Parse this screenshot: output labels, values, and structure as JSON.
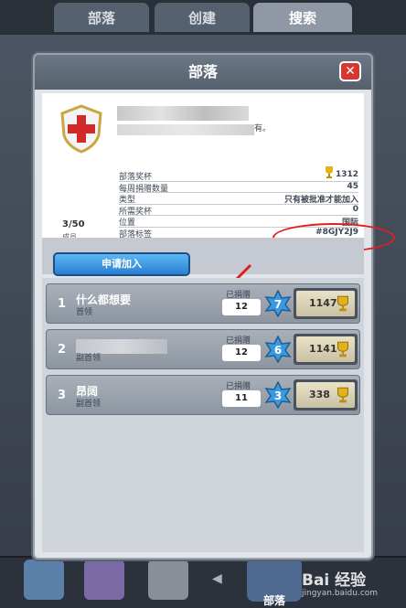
{
  "top_tabs": [
    {
      "label": "部落"
    },
    {
      "label": "创建"
    },
    {
      "label": "搜索"
    }
  ],
  "modal": {
    "title": "部落",
    "close_symbol": "✕",
    "description_tail": "有。",
    "stats": [
      {
        "label": "部落奖杯",
        "value": "1312"
      },
      {
        "label": "每周捐赠数量",
        "value": "45"
      },
      {
        "label": "类型",
        "value": "只有被批准才能加入"
      },
      {
        "label": "所需奖杯",
        "value": "0"
      },
      {
        "label": "位置",
        "value": "国际"
      },
      {
        "label": "部落标签",
        "value": "#8GJY2J9"
      }
    ],
    "members_count": "3/50",
    "members_label": "成员",
    "join_button": "申请加入",
    "members": [
      {
        "rank": "1",
        "name": "什么都想要",
        "role": "首领",
        "donated_label": "已捐赠",
        "donated": "12",
        "level": "7",
        "trophies": "1147"
      },
      {
        "rank": "2",
        "name": "",
        "role": "副首领",
        "donated_label": "已捐赠",
        "donated": "12",
        "level": "6",
        "trophies": "1141"
      },
      {
        "rank": "3",
        "name": "昂阔",
        "role": "副首领",
        "donated_label": "已捐赠",
        "donated": "11",
        "level": "3",
        "trophies": "338"
      }
    ]
  },
  "bottom_nav": {
    "active_label": "部落"
  },
  "watermark": {
    "brand": "Bai 经验",
    "url": "jingyan.baidu.com"
  },
  "colors": {
    "accent_blue": "#2a7fd0",
    "close_red": "#d9362f",
    "annotation_red": "#e02020"
  },
  "icons": [
    "shield-cross-icon",
    "trophy-icon",
    "level-star-icon",
    "close-icon",
    "arrow-annotation"
  ]
}
